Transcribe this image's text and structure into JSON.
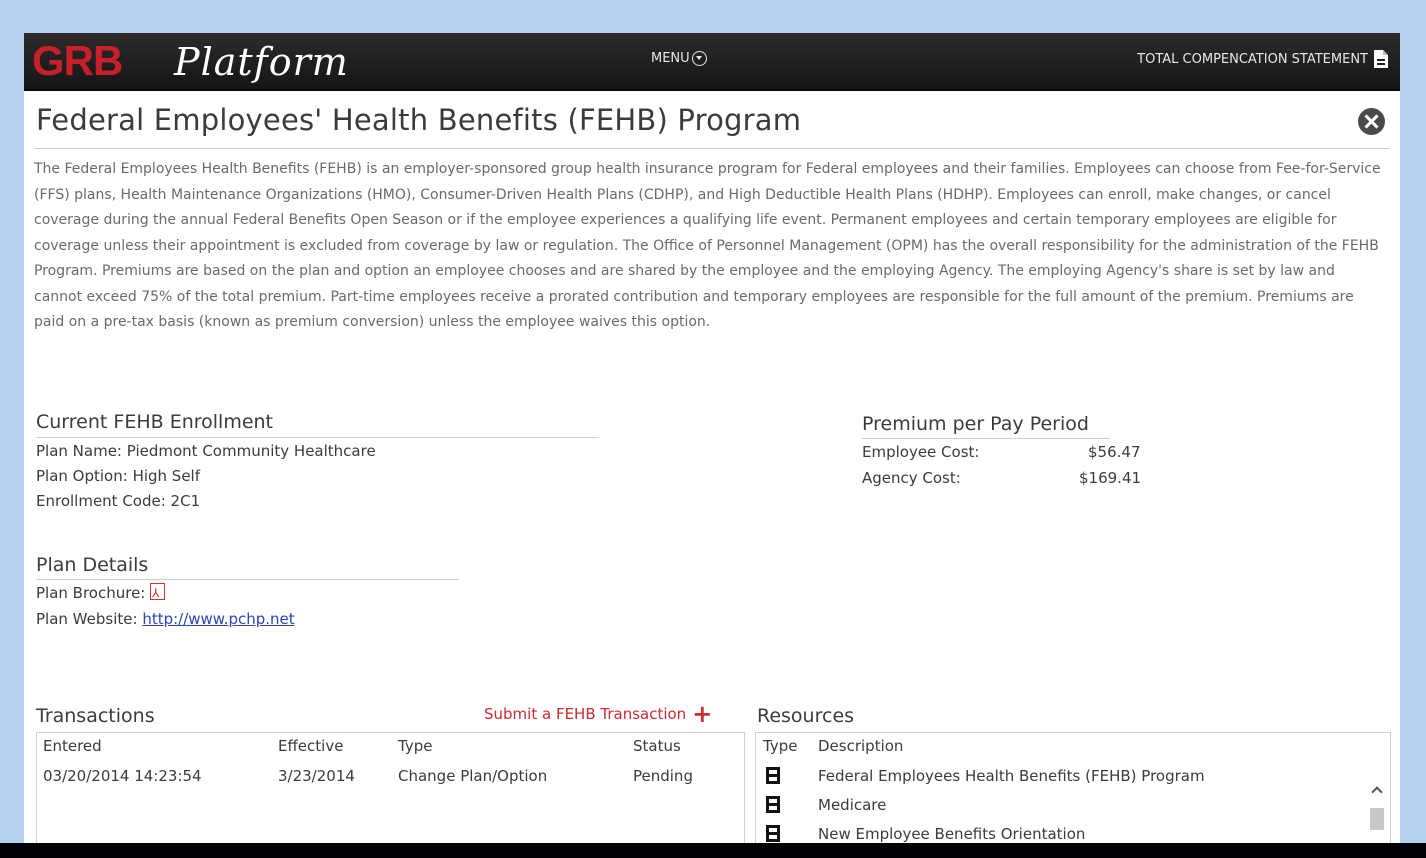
{
  "header": {
    "logo_brand": "GRB",
    "logo_product": "Platform",
    "menu_label": "MENU",
    "statement_label": "TOTAL COMPENCATION STATEMENT"
  },
  "page": {
    "title": "Federal Employees' Health Benefits (FEHB) Program",
    "description": "The Federal Employees Health Benefits (FEHB) is an employer-sponsored group health insurance program for Federal employees and their families. Employees can choose from Fee-for-Service (FFS) plans, Health Maintenance Organizations (HMO), Consumer-Driven Health Plans (CDHP), and High Deductible Health Plans (HDHP). Employees can enroll, make changes, or cancel coverage during the annual Federal Benefits Open Season or if the employee experiences a qualifying life event. Permanent employees and certain temporary employees are eligible for coverage unless their appointment is excluded from coverage by law or regulation. The Office of Personnel Management (OPM) has the overall responsibility for the administration of the FEHB Program. Premiums are based on the plan and option an employee chooses and are shared by the employee and the employing Agency. The employing Agency's share is set by law and cannot exceed 75% of the total premium. Part-time employees receive a prorated contribution and temporary employees are responsible for the full amount of the premium. Premiums are paid on a pre-tax basis (known as premium conversion) unless the employee waives this option."
  },
  "enrollment": {
    "heading": "Current FEHB Enrollment",
    "plan_name": "Plan Name: Piedmont Community Healthcare",
    "plan_option": "Plan Option: High Self",
    "enrollment_code": "Enrollment Code: 2C1"
  },
  "premium": {
    "heading": "Premium per Pay Period",
    "employee_label": "Employee Cost:",
    "employee_value": "$56.47",
    "agency_label": "Agency Cost:",
    "agency_value": "$169.41"
  },
  "plan_details": {
    "heading": "Plan Details",
    "brochure_label": "Plan Brochure:",
    "website_label": "Plan Website:",
    "website_url": "http://www.pchp.net"
  },
  "transactions": {
    "heading": "Transactions",
    "submit_label": "Submit a FEHB Transaction",
    "columns": [
      "Entered",
      "Effective",
      "Type",
      "Status"
    ],
    "rows": [
      [
        "03/20/2014 14:23:54",
        "3/23/2014",
        "Change Plan/Option",
        "Pending"
      ]
    ]
  },
  "resources": {
    "heading": "Resources",
    "columns": [
      "Type",
      "Description"
    ],
    "items": [
      {
        "icon": "document-icon",
        "description": "Federal Employees Health Benefits (FEHB) Program"
      },
      {
        "icon": "document-icon",
        "description": "Medicare"
      },
      {
        "icon": "document-icon",
        "description": "New Employee Benefits Orientation"
      }
    ]
  },
  "colors": {
    "brand_red": "#c8202a",
    "topbar": "#1f1d1e",
    "link_blue": "#2a45b8",
    "frame_blue": "#b6d0f1"
  }
}
